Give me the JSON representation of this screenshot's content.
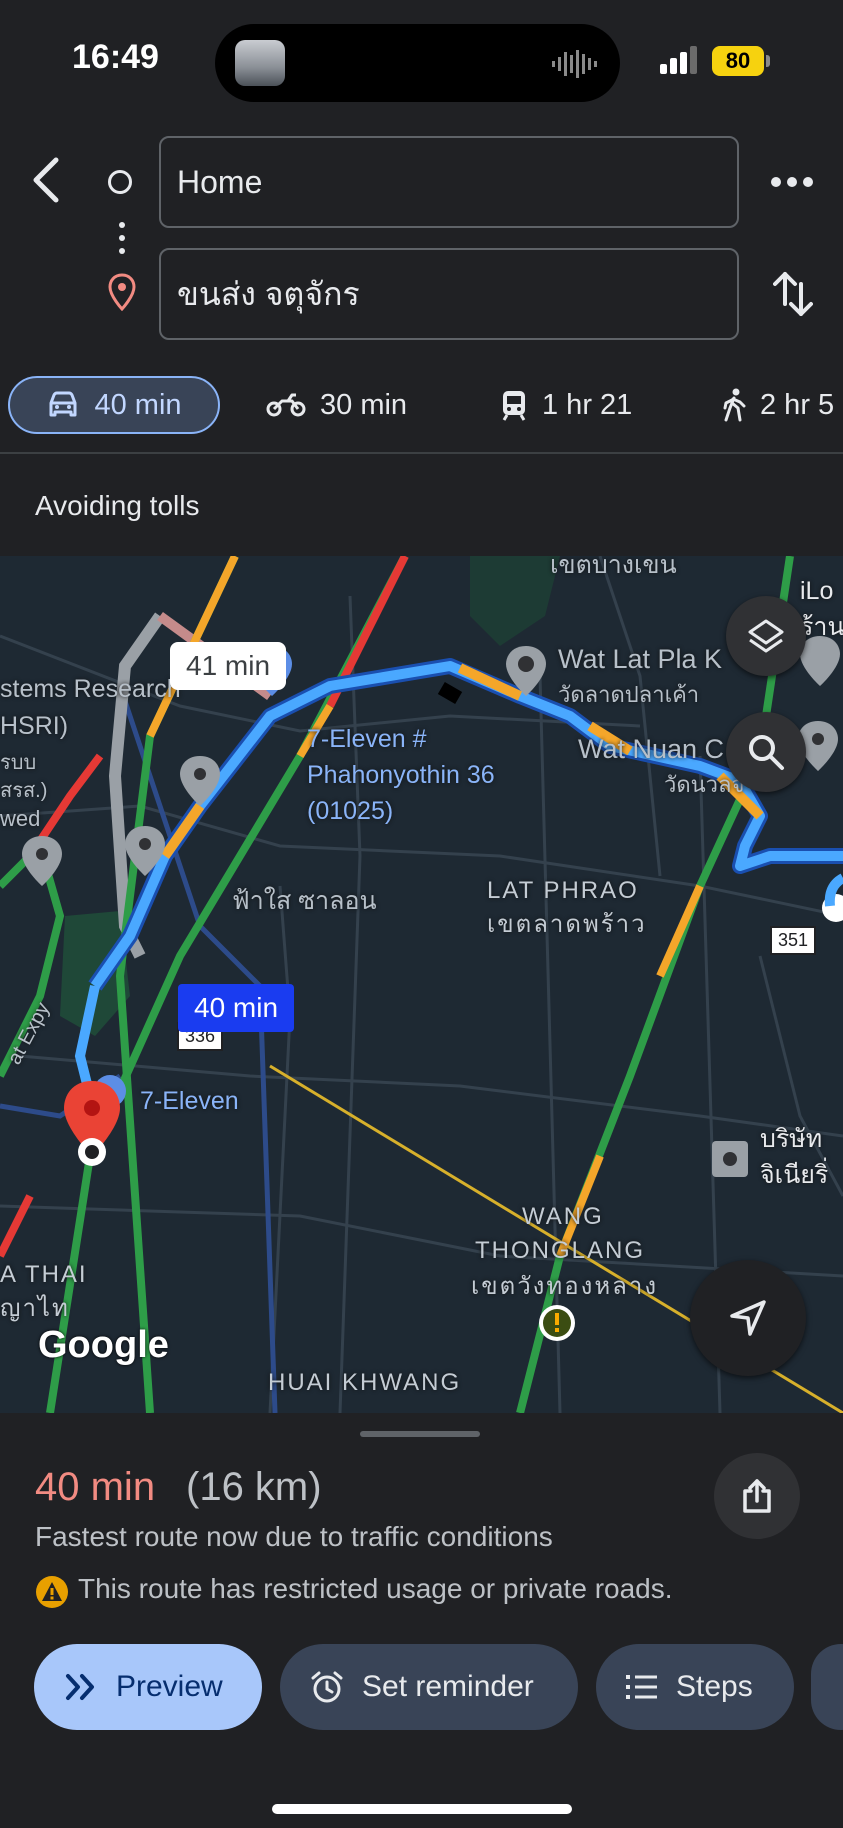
{
  "status": {
    "time": "16:49",
    "battery": "80"
  },
  "header": {
    "origin": "Home",
    "destination": "ขนส่ง จตุจักร"
  },
  "modes": [
    {
      "icon": "car-icon",
      "label": "40 min"
    },
    {
      "icon": "motorcycle-icon",
      "label": "30 min"
    },
    {
      "icon": "train-icon",
      "label": "1 hr 21"
    },
    {
      "icon": "walk-icon",
      "label": "2 hr 5"
    }
  ],
  "options": {
    "avoid": "Avoiding tolls"
  },
  "map": {
    "labels": {
      "systems": "stems Research",
      "hsri": "HSRI)",
      "th1": "รบบ",
      "th2": "สรส.)",
      "wed": "wed",
      "top_thai": "เขตบางเขน",
      "ilo": "iLo",
      "ilo_th": "ร้าน",
      "wat_lat_pla": "Wat Lat Pla K",
      "wat_lat_pla_th": "วัดลาดปลาเค้า",
      "wat_nuan": "Wat Nuan C",
      "wat_nuan_th": "วัดนวลจ",
      "seven_eleven_1": "7-Eleven #",
      "seven_eleven_2": "Phahonyothin 36",
      "seven_eleven_3": "(01025)",
      "fa_sai": "ฟ้าใส ซาลอน",
      "lat_phrao": "LAT PHRAO",
      "lat_phrao_th": "เขตลาดพร้าว",
      "seven_eleven_b": "7-Eleven",
      "company_1": "บริษัท",
      "company_2": "จิเนียริ่",
      "wang_1": "WANG",
      "wang_2": "THONGLANG",
      "wang_th": "เขตวังทองหลาง",
      "phaya_thai": "A THAI",
      "phaya_thai_th": "ญาไท",
      "huai_khwang": "HUAI KHWANG",
      "expy": "at Expy",
      "route_351": "351",
      "route_336": "336"
    },
    "bubble_alt": "41 min",
    "bubble_main": "40 min",
    "logo": "Google"
  },
  "summary": {
    "eta": "40 min",
    "distance": "(16 km)",
    "description": "Fastest route now due to traffic conditions",
    "warning": "This route has restricted usage or private roads."
  },
  "actions": {
    "preview": "Preview",
    "reminder": "Set reminder",
    "steps": "Steps"
  },
  "colors": {
    "route": "#4aa8ff",
    "traffic_green": "#2e9d48",
    "traffic_orange": "#f4a62a",
    "traffic_red": "#e53935",
    "accent": "#8ab4f8"
  }
}
